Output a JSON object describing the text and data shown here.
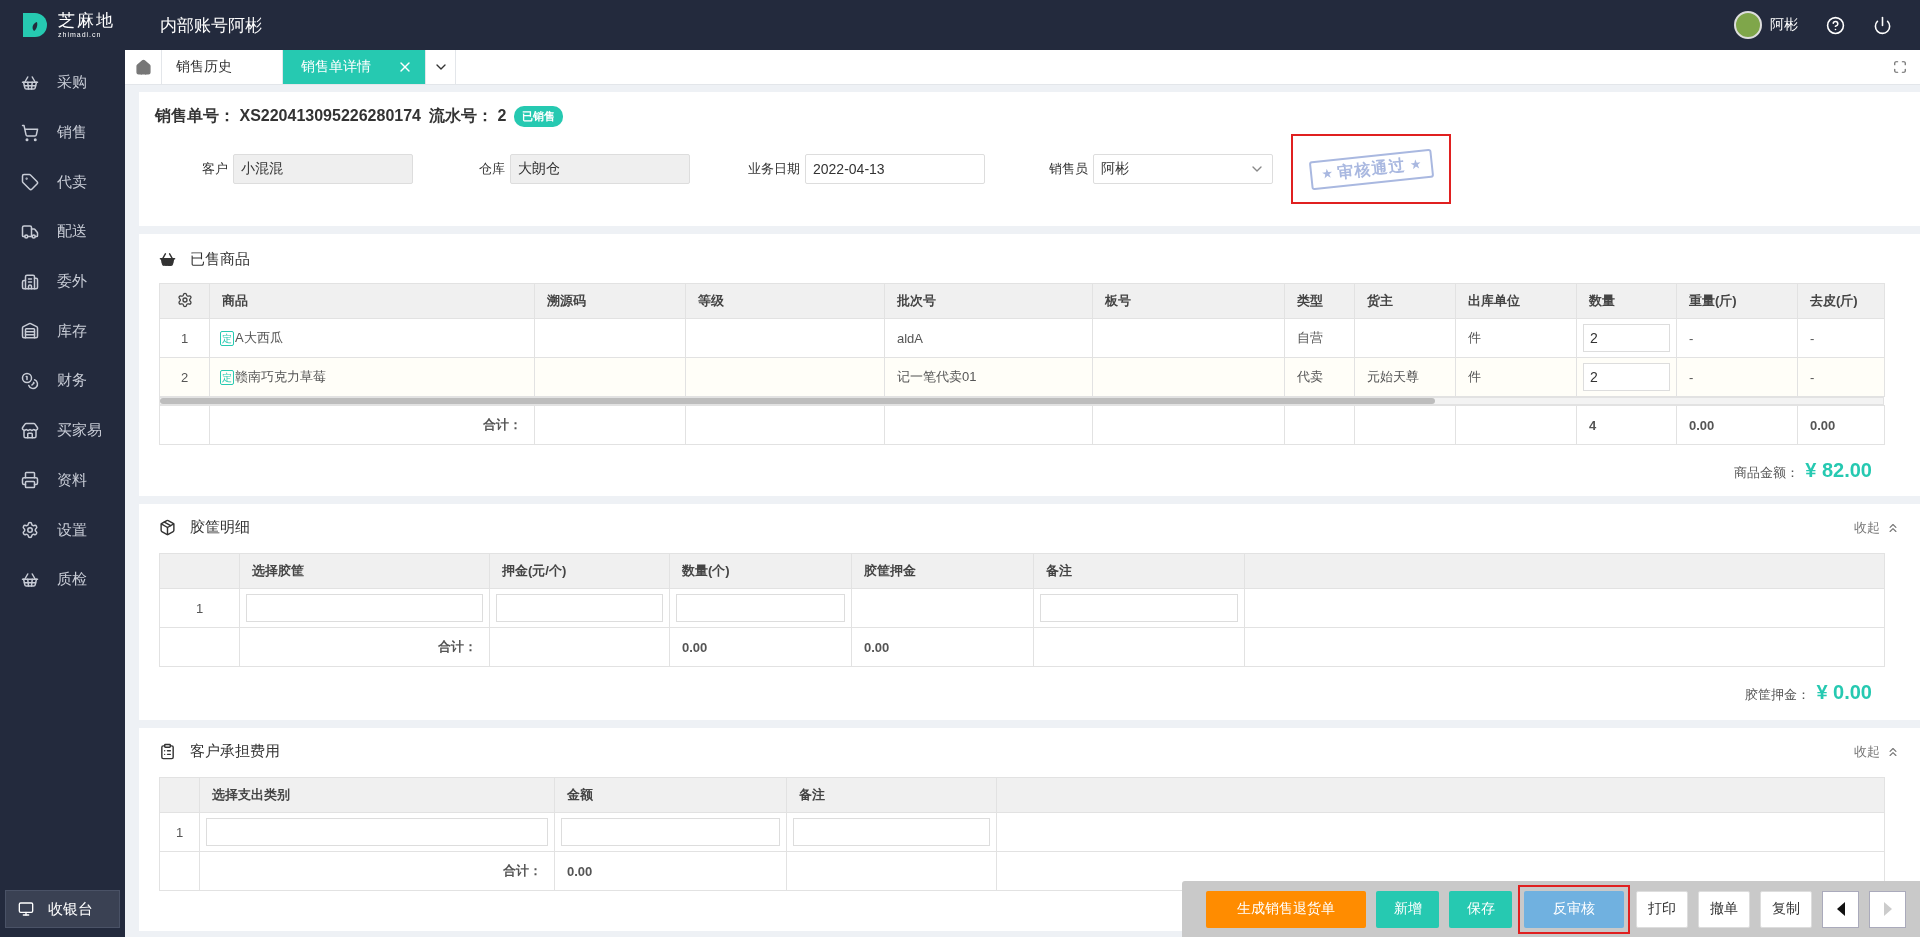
{
  "logo": {
    "name": "芝麻地",
    "domain": "zhimadi.cn"
  },
  "account_title": "内部账号阿彬",
  "user": {
    "name": "阿彬"
  },
  "sidebar": {
    "items": [
      {
        "label": "采购"
      },
      {
        "label": "销售"
      },
      {
        "label": "代卖"
      },
      {
        "label": "配送"
      },
      {
        "label": "委外"
      },
      {
        "label": "库存"
      },
      {
        "label": "财务"
      },
      {
        "label": "买家易"
      },
      {
        "label": "资料"
      },
      {
        "label": "设置"
      },
      {
        "label": "质检"
      }
    ],
    "cashier": "收银台"
  },
  "tabs": [
    {
      "label": "销售历史",
      "selected": false
    },
    {
      "label": "销售单详情",
      "selected": true
    }
  ],
  "order": {
    "no_label": "销售单号：",
    "no": "XS220413095226280174",
    "serial_label": "流水号：",
    "serial": "2",
    "status": "已销售",
    "fields": [
      {
        "label": "客户",
        "value": "小混混",
        "kind": "readonly"
      },
      {
        "label": "仓库",
        "value": "大朗仓",
        "kind": "readonly"
      },
      {
        "label": "业务日期",
        "value": "2022-04-13",
        "kind": "input"
      },
      {
        "label": "销售员",
        "value": "阿彬",
        "kind": "select"
      }
    ],
    "stamp": {
      "text": "审核通过",
      "highlighted": true
    }
  },
  "goods": {
    "title": "已售商品",
    "columns": [
      "商品",
      "溯源码",
      "等级",
      "批次号",
      "板号",
      "类型",
      "货主",
      "出库单位",
      "数量",
      "重量(斤)",
      "去皮(斤)"
    ],
    "rows": [
      {
        "index": "1",
        "tag": "定",
        "name": "A大西瓜",
        "trace": "",
        "grade": "",
        "batch": "aldA",
        "board": "",
        "type": "自营",
        "owner": "",
        "unit": "件",
        "qty": "2",
        "weight": "-",
        "tare": "-"
      },
      {
        "index": "2",
        "tag": "定",
        "name": "赣南巧克力草莓",
        "trace": "",
        "grade": "",
        "batch": "记一笔代卖01",
        "board": "",
        "type": "代卖",
        "owner": "元始天尊",
        "unit": "件",
        "qty": "2",
        "weight": "-",
        "tare": "-"
      }
    ],
    "total_label": "合计：",
    "total_qty": "4",
    "total_weight": "0.00",
    "total_tare": "0.00",
    "amount_label": "商品金额：",
    "amount": "¥ 82.00"
  },
  "crates": {
    "title": "胶筐明细",
    "collapse": "收起",
    "columns": [
      "选择胶筐",
      "押金(元/个)",
      "数量(个)",
      "胶筐押金",
      "备注"
    ],
    "rows": [
      {
        "index": "1"
      }
    ],
    "total_label": "合计：",
    "total_qty": "0.00",
    "total_deposit": "0.00",
    "amount_label": "胶筐押金：",
    "amount": "¥ 0.00"
  },
  "fees": {
    "title": "客户承担费用",
    "collapse": "收起",
    "columns": [
      "选择支出类别",
      "金额",
      "备注"
    ],
    "rows": [
      {
        "index": "1"
      }
    ],
    "total_label": "合计：",
    "total_amount": "0.00"
  },
  "actions": [
    {
      "label": "生成销售退货单",
      "kind": "orange",
      "highlighted": false
    },
    {
      "label": "新增",
      "kind": "teal",
      "highlighted": false
    },
    {
      "label": "保存",
      "kind": "teal",
      "highlighted": false
    },
    {
      "label": "反审核",
      "kind": "blue",
      "highlighted": true
    },
    {
      "label": "打印",
      "kind": "plain",
      "highlighted": false
    },
    {
      "label": "撤单",
      "kind": "plain",
      "highlighted": false
    },
    {
      "label": "复制",
      "kind": "plain",
      "highlighted": false
    }
  ]
}
